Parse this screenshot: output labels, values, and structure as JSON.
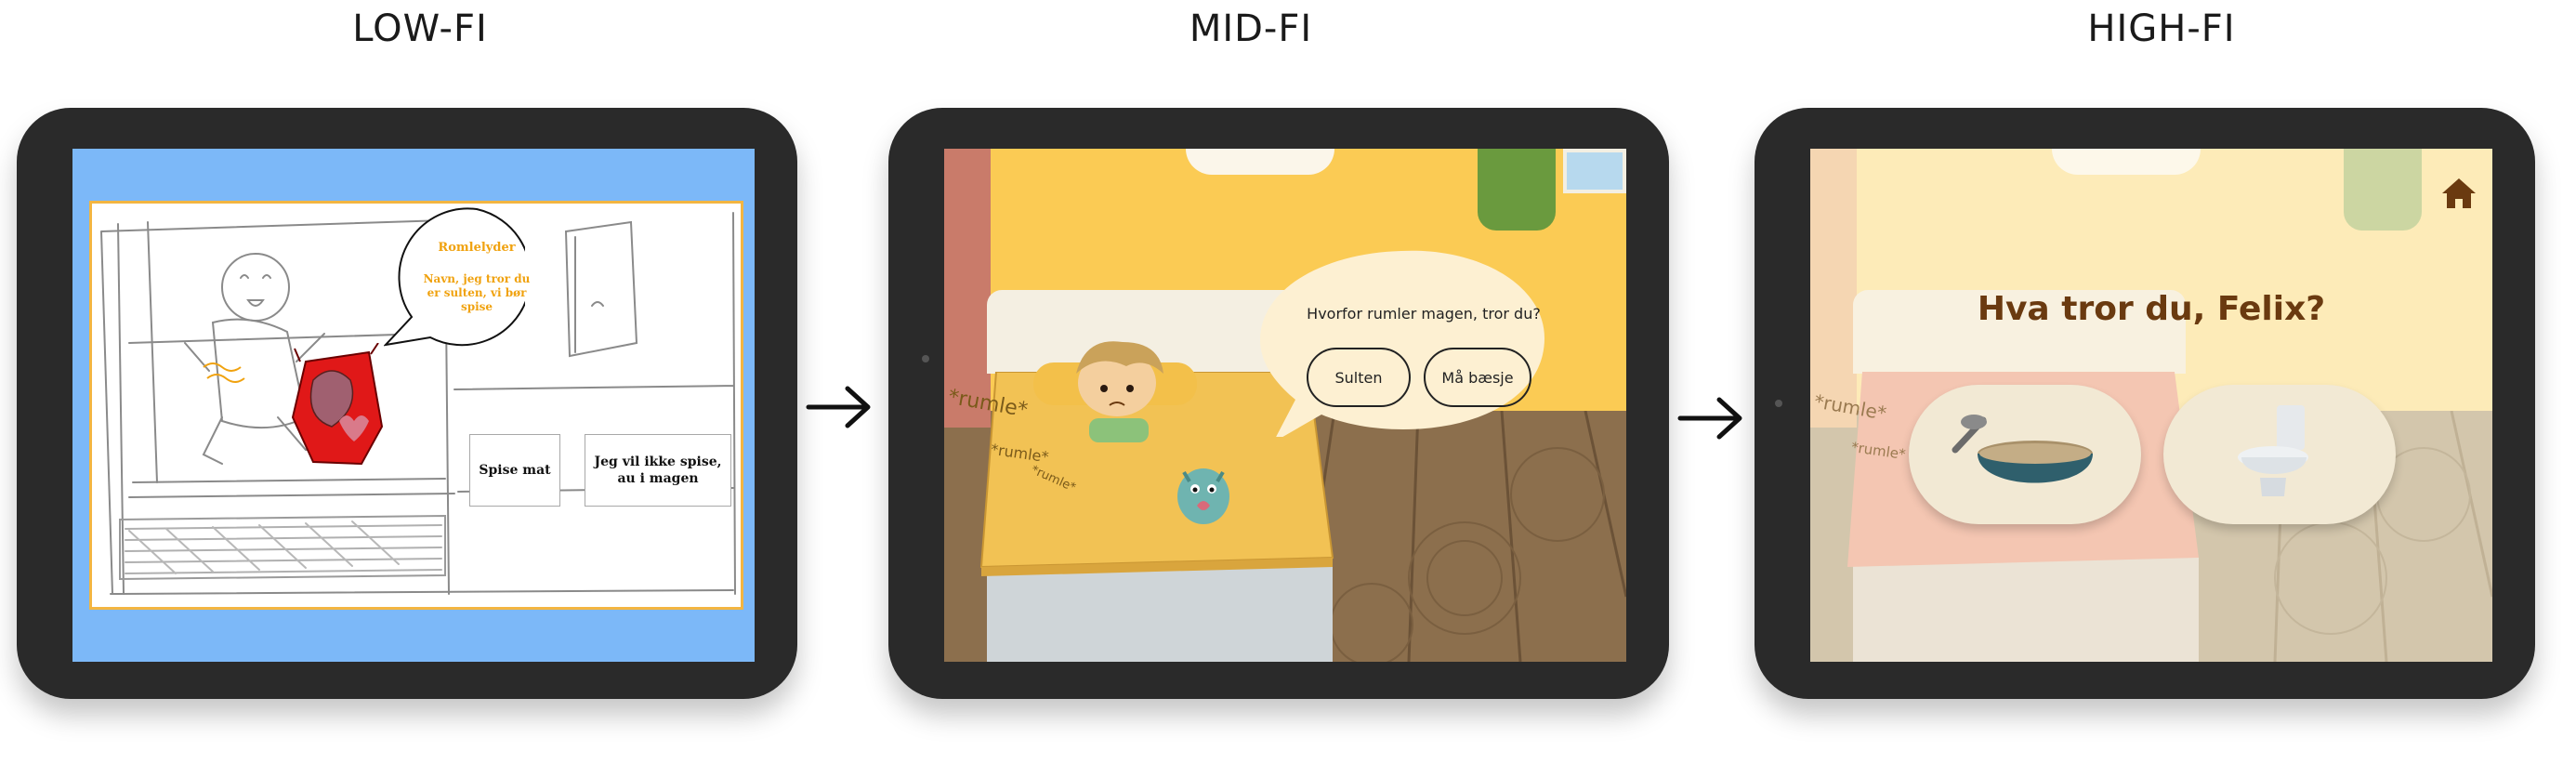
{
  "stages": {
    "lofi_title": "LOW-FI",
    "midfi_title": "MID-FI",
    "hifi_title": "HIGH-FI"
  },
  "lofi": {
    "bubble_title": "Romlelyder",
    "bubble_text": "Navn, jeg tror du er sulten, vi bør spise",
    "btn_eat": "Spise mat",
    "btn_no_eat": "Jeg vil ikke spise, au i magen"
  },
  "midfi": {
    "question": "Hvorfor rumler magen, tror du?",
    "btn_hungry": "Sulten",
    "btn_poop": "Må bæsje",
    "rumle_1": "*rumle*",
    "rumle_2": "*rumle*",
    "rumle_3": "*rumle*"
  },
  "hifi": {
    "question": "Hva tror du, Felix?",
    "rumle_1": "*rumle*",
    "rumle_2": "*rumle*",
    "choices": [
      "bowl-of-porridge",
      "toilet"
    ],
    "home_icon": "home-icon"
  },
  "colors": {
    "lofi_background": "#7cb8f8",
    "lofi_accent": "#f0a20f",
    "midfi_wall": "#fbcb54",
    "hifi_title": "#6a3a10",
    "tablet_frame": "#2a2a2a"
  }
}
